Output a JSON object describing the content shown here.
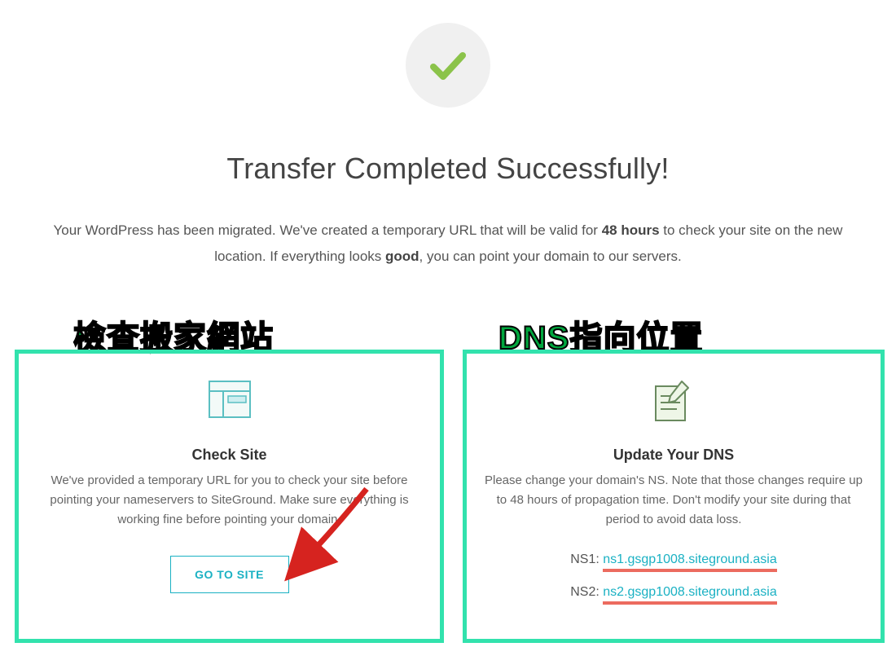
{
  "header": {
    "title": "Transfer Completed Successfully!",
    "sub_before": "Your WordPress has been migrated. We've created a temporary URL that will be valid for ",
    "sub_bold1": "48 hours",
    "sub_mid": " to check your site on the new location. If everything looks ",
    "sub_bold2": "good",
    "sub_after": ", you can point your domain to our servers.",
    "icon": "check-icon"
  },
  "left": {
    "overlay": "檢查搬家網站",
    "icon": "site-preview-icon",
    "heading": "Check Site",
    "body": "We've provided a temporary URL for you to check your site before pointing your nameservers to SiteGround. Make sure everything is working fine before pointing your domain.",
    "button": "GO TO SITE"
  },
  "right": {
    "overlay": "DNS指向位置",
    "icon": "edit-note-icon",
    "heading": "Update Your DNS",
    "body": "Please change your domain's NS. Note that those changes require up to 48 hours of propagation time. Don't modify your site during that period to avoid data loss.",
    "ns1_label": "NS1:",
    "ns1_value": "ns1.gsgp1008.siteground.asia",
    "ns2_label": "NS2:",
    "ns2_value": "ns2.gsgp1008.siteground.asia"
  }
}
